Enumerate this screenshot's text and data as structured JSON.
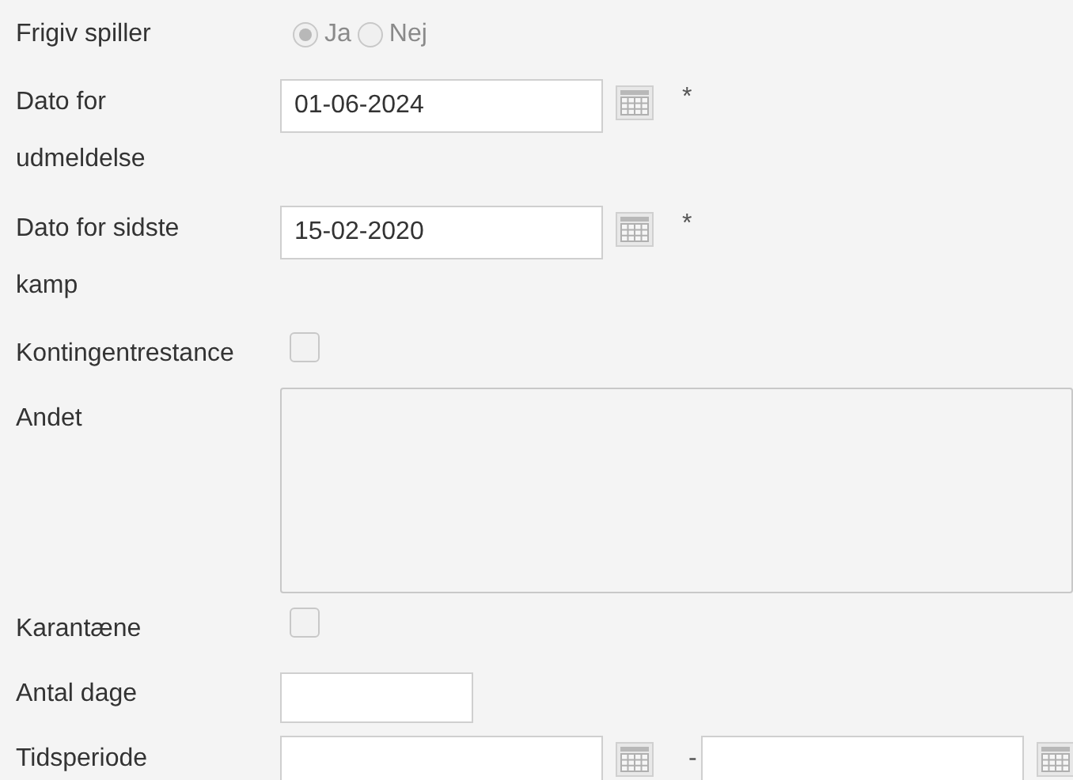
{
  "fields": [
    {
      "kind": "radio",
      "label": "Frigiv spiller",
      "disabled": true,
      "options": [
        {
          "label": "Ja",
          "selected": true
        },
        {
          "label": "Nej",
          "selected": false
        }
      ]
    },
    {
      "kind": "date",
      "label": "Dato for udmeldelse",
      "value": "01-06-2024",
      "required": "*"
    },
    {
      "kind": "date",
      "label": "Dato for sidste kamp",
      "value": "15-02-2020",
      "required": "*"
    },
    {
      "kind": "checkbox",
      "label": "Kontingentrestance",
      "checked": false
    },
    {
      "kind": "textarea",
      "label": "Andet"
    },
    {
      "kind": "checkbox",
      "label": "Karantæne",
      "checked": false
    },
    {
      "kind": "number",
      "label": "Antal dage"
    },
    {
      "kind": "daterange",
      "label": "Tidsperiode",
      "separator": "-"
    }
  ]
}
